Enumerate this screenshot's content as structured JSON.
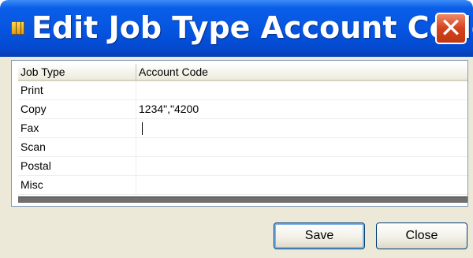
{
  "window": {
    "title": "Edit Job Type Account Codes",
    "close_symbol": "✕"
  },
  "table": {
    "columns": [
      "Job Type",
      "Account Code"
    ],
    "rows": [
      {
        "job_type": "Print",
        "account_code": ""
      },
      {
        "job_type": "Copy",
        "account_code": "1234\",\"4200"
      },
      {
        "job_type": "Fax",
        "account_code": ""
      },
      {
        "job_type": "Scan",
        "account_code": ""
      },
      {
        "job_type": "Postal",
        "account_code": ""
      },
      {
        "job_type": "Misc",
        "account_code": ""
      }
    ]
  },
  "buttons": {
    "save_label": "Save",
    "close_label": "Close"
  },
  "colors": {
    "titlebar": "#0554e0",
    "close_button": "#d2421c",
    "dialog_background": "#ece9d8"
  },
  "icons": {
    "app": "grid-app-icon",
    "close": "close-icon"
  }
}
